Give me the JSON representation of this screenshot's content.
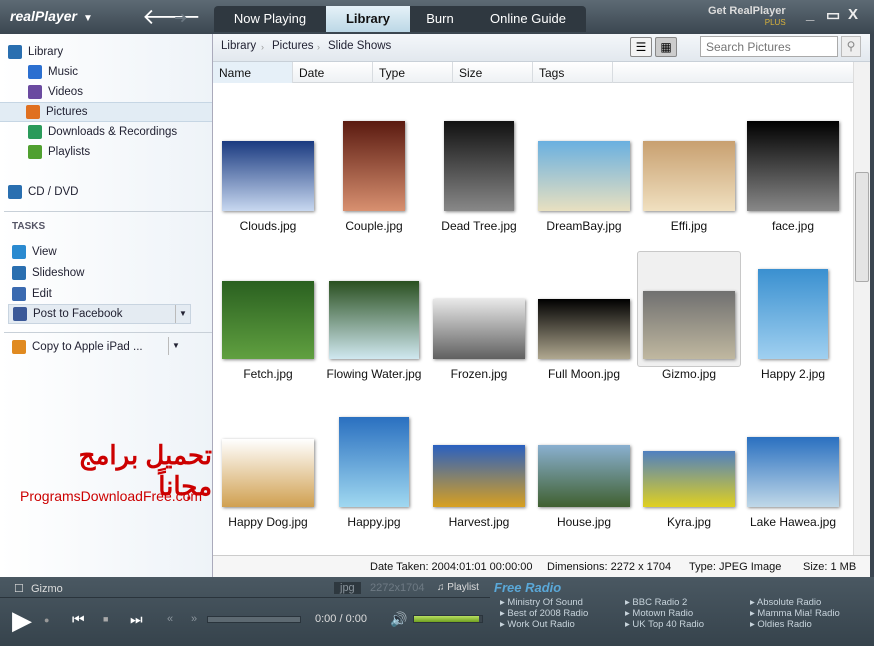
{
  "app": {
    "logo": "realPlayer",
    "get": "Get RealPlayer",
    "plus": "PLUS",
    "minimize": "_",
    "maximize": "▭",
    "close": "X"
  },
  "tabs": [
    {
      "label": "Now Playing"
    },
    {
      "label": "Library",
      "active": true
    },
    {
      "label": "Burn"
    },
    {
      "label": "Online Guide"
    }
  ],
  "sidebar": {
    "items": [
      {
        "label": "Library",
        "icon": "library-icon",
        "color": "#2a6fb0"
      },
      {
        "label": "Music",
        "icon": "music-note-icon",
        "color": "#2b6fd0"
      },
      {
        "label": "Videos",
        "icon": "film-icon",
        "color": "#6a4aa0"
      },
      {
        "label": "Pictures",
        "icon": "camera-icon",
        "color": "#e07020",
        "selected": true
      },
      {
        "label": "Downloads & Recordings",
        "icon": "download-icon",
        "color": "#2a9a5a"
      },
      {
        "label": "Playlists",
        "icon": "playlist-icon",
        "color": "#50a030"
      },
      {
        "label": "CD / DVD",
        "icon": "disc-icon",
        "color": "#2a6fb0"
      }
    ],
    "tasks_heading": "TASKS",
    "tasks": [
      {
        "label": "View",
        "icon": "play-icon",
        "color": "#2a8ad0"
      },
      {
        "label": "Slideshow",
        "icon": "slideshow-icon",
        "color": "#2a6fb0"
      },
      {
        "label": "Edit",
        "icon": "pencil-icon",
        "color": "#3a6ab0"
      },
      {
        "label": "Post to Facebook",
        "icon": "facebook-icon",
        "color": "#3b5998"
      },
      {
        "label": "Copy to Apple iPad ...",
        "icon": "copy-device-icon",
        "color": "#e08a20"
      }
    ],
    "watermark_arabic": "تحميل برامج مجاناً",
    "watermark_site": "ProgramsDownloadFree.com"
  },
  "breadcrumb": [
    "Library",
    "Pictures",
    "Slide Shows"
  ],
  "search": {
    "placeholder": "Search Pictures"
  },
  "columns": [
    "Name",
    "Date",
    "Type",
    "Size",
    "Tags"
  ],
  "pictures": [
    {
      "name": "Clouds.jpg",
      "colors": [
        "#1a3a80",
        "#c8d8f0"
      ]
    },
    {
      "name": "Couple.jpg",
      "colors": [
        "#5a1a10",
        "#d89070"
      ]
    },
    {
      "name": "Dead Tree.jpg",
      "colors": [
        "#111",
        "#888"
      ]
    },
    {
      "name": "DreamBay.jpg",
      "colors": [
        "#6ab0e0",
        "#e8e0c0"
      ]
    },
    {
      "name": "Effi.jpg",
      "colors": [
        "#c8a070",
        "#f0e0c0"
      ]
    },
    {
      "name": "face.jpg",
      "colors": [
        "#000",
        "#888"
      ]
    },
    {
      "name": "Fetch.jpg",
      "colors": [
        "#2a6020",
        "#60a040"
      ]
    },
    {
      "name": "Flowing Water.jpg",
      "colors": [
        "#2a5020",
        "#d0e8f0"
      ]
    },
    {
      "name": "Frozen.jpg",
      "colors": [
        "#e8e8e8",
        "#606060"
      ]
    },
    {
      "name": "Full Moon.jpg",
      "colors": [
        "#000",
        "#b0a890"
      ]
    },
    {
      "name": "Gizmo.jpg",
      "colors": [
        "#707070",
        "#c0b8a0"
      ],
      "selected": true
    },
    {
      "name": "Happy 2.jpg",
      "colors": [
        "#3a90d0",
        "#a0d0f0"
      ]
    },
    {
      "name": "Happy Dog.jpg",
      "colors": [
        "#fff",
        "#d0a050"
      ]
    },
    {
      "name": "Happy.jpg",
      "colors": [
        "#2a70c0",
        "#a0d8f0"
      ]
    },
    {
      "name": "Harvest.jpg",
      "colors": [
        "#2a60c0",
        "#d8a020"
      ]
    },
    {
      "name": "House.jpg",
      "colors": [
        "#8ab0d0",
        "#406030"
      ]
    },
    {
      "name": "Kyra.jpg",
      "colors": [
        "#5080c0",
        "#e0d020"
      ]
    },
    {
      "name": "Lake Hawea.jpg",
      "colors": [
        "#2a70c0",
        "#c0d8e8"
      ]
    }
  ],
  "status": {
    "date": "Date Taken: 2004:01:01 00:00:00",
    "dimensions": "Dimensions: 2272 x 1704",
    "type": "Type: JPEG Image",
    "size": "Size: 1 MB"
  },
  "player": {
    "title": "Gizmo",
    "format": "jpg",
    "res": "2272x1704",
    "playlist": "Playlist",
    "time": "0:00 / 0:00",
    "volume": 0.95,
    "progress": 0
  },
  "radio": {
    "heading": "Free Radio",
    "stations": [
      "Ministry Of Sound",
      "Best of 2008 Radio",
      "Work Out Radio",
      "BBC Radio 2",
      "Motown Radio",
      "UK Top 40 Radio",
      "Absolute Radio",
      "Mamma Mia! Radio",
      "Oldies Radio"
    ]
  }
}
